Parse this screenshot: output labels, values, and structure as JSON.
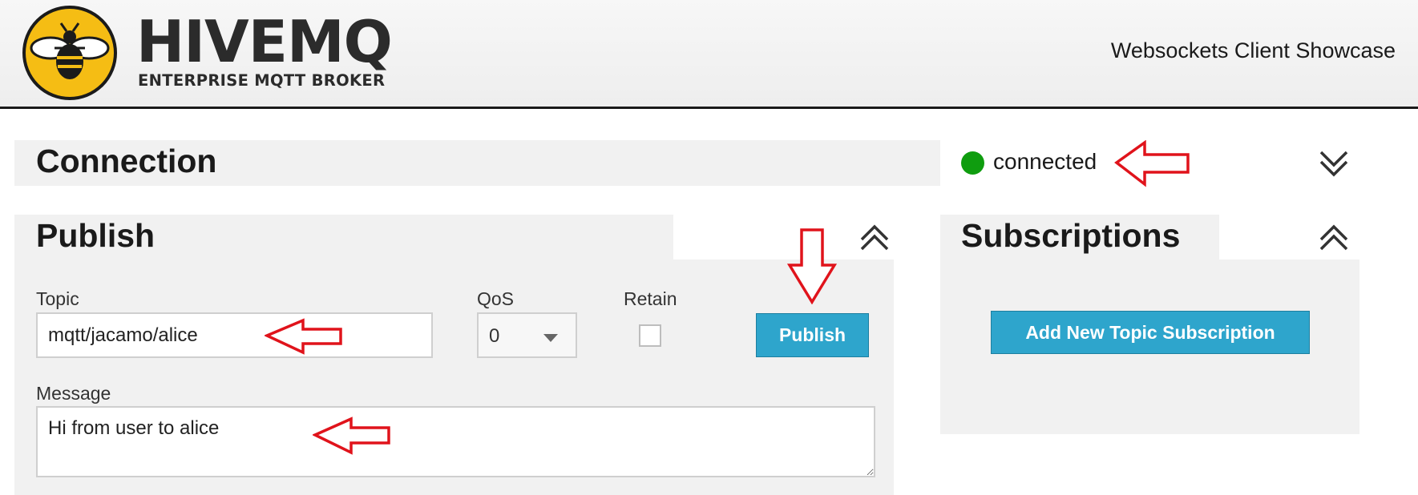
{
  "header": {
    "logo_name": "HIVEMQ",
    "logo_tagline": "ENTERPRISE MQTT BROKER",
    "title": "Websockets Client Showcase"
  },
  "connection": {
    "title": "Connection",
    "status": "connected",
    "status_color": "#0f9d0f",
    "toggle_icon": "chevron-double-down-icon"
  },
  "publish": {
    "title": "Publish",
    "toggle_icon": "chevron-double-up-icon",
    "topic_label": "Topic",
    "topic_value": "mqtt/jacamo/alice",
    "qos_label": "QoS",
    "qos_value": "0",
    "retain_label": "Retain",
    "retain_checked": false,
    "button_label": "Publish",
    "message_label": "Message",
    "message_value": "Hi from user to alice"
  },
  "subscriptions": {
    "title": "Subscriptions",
    "toggle_icon": "chevron-double-up-icon",
    "add_button_label": "Add New Topic Subscription"
  },
  "colors": {
    "accent": "#2ea5cc",
    "panel": "#f1f1f1",
    "logo_yellow": "#f5bd14",
    "annotation_arrow": "#e0131b"
  }
}
